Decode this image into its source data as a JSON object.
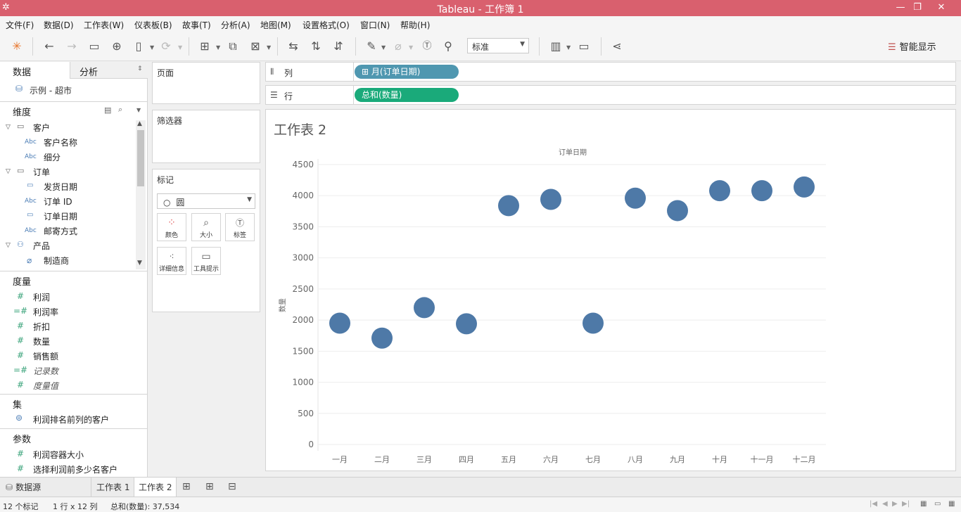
{
  "window": {
    "title": "Tableau - 工作簿 1",
    "minimize": "—",
    "restore": "❐",
    "close": "✕"
  },
  "menu": [
    "文件(F)",
    "数据(D)",
    "工作表(W)",
    "仪表板(B)",
    "故事(T)",
    "分析(A)",
    "地图(M)",
    "设置格式(O)",
    "窗口(N)",
    "帮助(H)"
  ],
  "toolbar": {
    "fit": "标准",
    "show_me": "智能显示"
  },
  "data_pane": {
    "tab_data": "数据",
    "tab_analysis": "分析",
    "datasource": "示例 - 超市",
    "dimensions_label": "维度",
    "dimensions": [
      {
        "label": "客户",
        "type": "folder"
      },
      {
        "label": "客户名称",
        "type": "abc"
      },
      {
        "label": "细分",
        "type": "abc"
      },
      {
        "label": "订单",
        "type": "folder"
      },
      {
        "label": "发货日期",
        "type": "date"
      },
      {
        "label": "订单 ID",
        "type": "abc"
      },
      {
        "label": "订单日期",
        "type": "date"
      },
      {
        "label": "邮寄方式",
        "type": "abc"
      },
      {
        "label": "产品",
        "type": "hierarchy"
      },
      {
        "label": "制造商",
        "type": "clip"
      }
    ],
    "measures_label": "度量",
    "measures": [
      {
        "label": "利润",
        "italic": false
      },
      {
        "label": "利润率",
        "italic": false
      },
      {
        "label": "折扣",
        "italic": false
      },
      {
        "label": "数量",
        "italic": false
      },
      {
        "label": "销售额",
        "italic": false
      },
      {
        "label": "记录数",
        "italic": true
      },
      {
        "label": "度量值",
        "italic": true
      }
    ],
    "sets_label": "集",
    "sets": [
      "利润排名前列的客户"
    ],
    "params_label": "参数",
    "params": [
      "利润容器大小",
      "选择利润前多少名客户"
    ]
  },
  "cards": {
    "pages": "页面",
    "filters": "筛选器",
    "marks": "标记",
    "mark_type": "圆",
    "mark_buttons": [
      {
        "label": "颜色",
        "icon": "color-icon"
      },
      {
        "label": "大小",
        "icon": "size-icon"
      },
      {
        "label": "标签",
        "icon": "label-icon"
      },
      {
        "label": "详细信息",
        "icon": "detail-icon"
      },
      {
        "label": "工具提示",
        "icon": "tooltip-icon"
      }
    ]
  },
  "shelves": {
    "columns_label": "列",
    "columns_pill": "月(订单日期)",
    "columns_pill_prefix": "⊞",
    "columns_color": "#4f97b0",
    "rows_label": "行",
    "rows_pill": "总和(数量)",
    "rows_color": "#1aaa7a"
  },
  "sheet": {
    "title": "工作表 2"
  },
  "chart_data": {
    "type": "scatter",
    "title": "订单日期",
    "ylabel": "数量",
    "categories": [
      "一月",
      "二月",
      "三月",
      "四月",
      "五月",
      "六月",
      "七月",
      "八月",
      "九月",
      "十月",
      "十一月",
      "十二月"
    ],
    "values": [
      1950,
      1710,
      2200,
      1940,
      3840,
      3940,
      1950,
      3960,
      3760,
      4080,
      4080,
      4140
    ],
    "ylim": [
      0,
      4500
    ],
    "yticks": [
      0,
      500,
      1000,
      1500,
      2000,
      2500,
      3000,
      3500,
      4000,
      4500
    ],
    "color": "#4e79a7",
    "grid": true
  },
  "sheet_tabs": {
    "datasource": "数据源",
    "tabs": [
      "工作表 1",
      "工作表 2"
    ],
    "active": 1
  },
  "status": {
    "marks": "12 个标记",
    "dims": "1 行 x 12 列",
    "sum": "总和(数量): 37,534"
  }
}
